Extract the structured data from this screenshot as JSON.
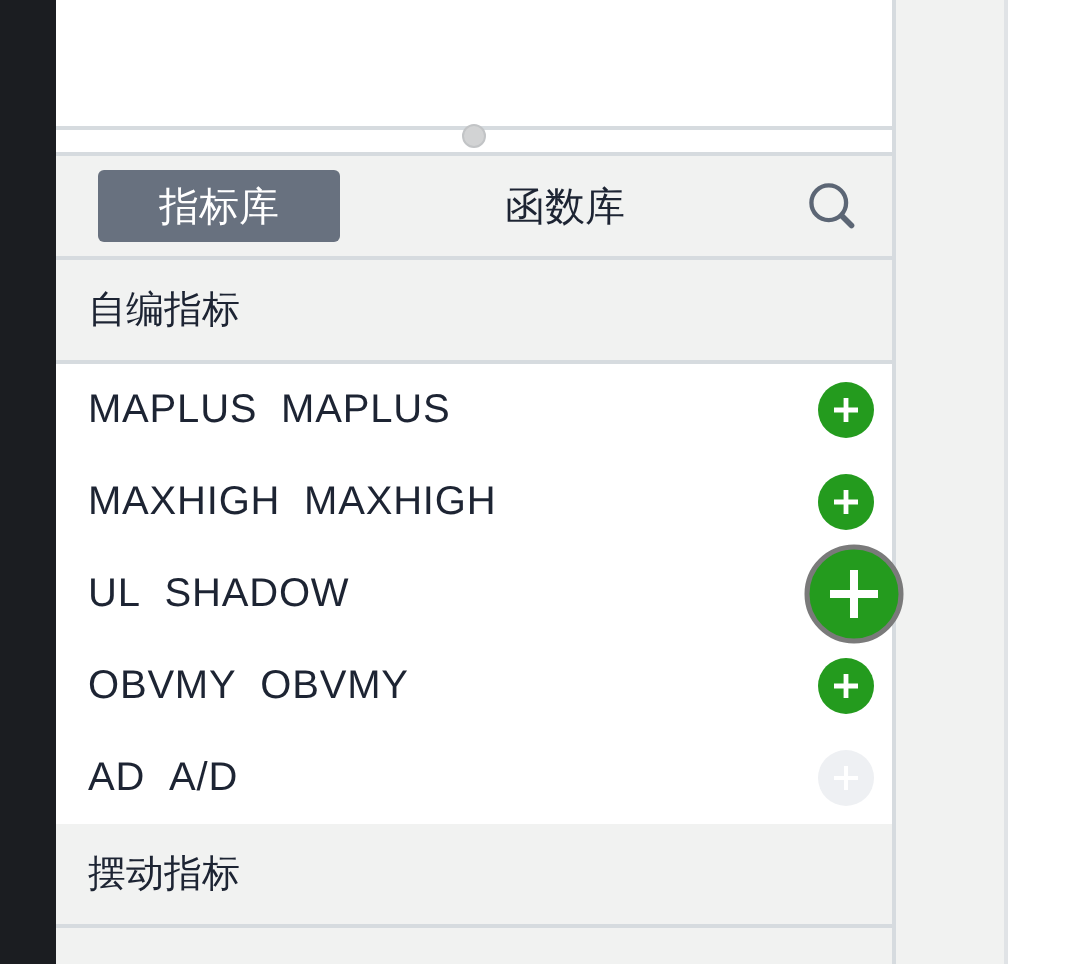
{
  "tabs": [
    {
      "label": "指标库",
      "selected": true
    },
    {
      "label": "函数库",
      "selected": false
    }
  ],
  "sections": [
    {
      "title": "自编指标",
      "items": [
        {
          "code": "MAPLUS",
          "name": "MAPLUS",
          "hovered": false,
          "disabled": false
        },
        {
          "code": "MAXHIGH",
          "name": "MAXHIGH",
          "hovered": false,
          "disabled": false
        },
        {
          "code": "UL",
          "name": "SHADOW",
          "hovered": true,
          "disabled": false
        },
        {
          "code": "OBVMY",
          "name": "OBVMY",
          "hovered": false,
          "disabled": false
        },
        {
          "code": "AD",
          "name": "A/D",
          "hovered": false,
          "disabled": true
        }
      ]
    },
    {
      "title": "摆动指标"
    }
  ]
}
